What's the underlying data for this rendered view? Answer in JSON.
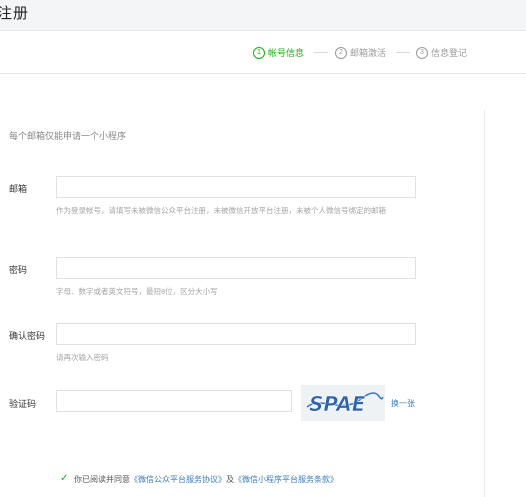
{
  "header": {
    "title": "注册"
  },
  "steps": [
    {
      "num": "1",
      "label": "帐号信息",
      "active": true
    },
    {
      "num": "2",
      "label": "邮箱激活",
      "active": false
    },
    {
      "num": "3",
      "label": "信息登记",
      "active": false
    }
  ],
  "form": {
    "intro": "每个邮箱仅能申请一个小程序",
    "email": {
      "label": "邮箱",
      "value": "",
      "hint": "作为登录帐号，请填写未被微信公众平台注册，未被微信开放平台注册，未被个人微信号绑定的邮箱"
    },
    "password": {
      "label": "密码",
      "value": "",
      "hint": "字母、数字或者英文符号，最短8位，区分大小写"
    },
    "confirm": {
      "label": "确认密码",
      "value": "",
      "hint": "请再次输入密码"
    },
    "captcha": {
      "label": "验证码",
      "value": "",
      "image_text": "SPAE",
      "refresh": "换一张"
    }
  },
  "agreement": {
    "prefix": "你已阅读并同意",
    "link1": "《微信公众平台服务协议》",
    "joiner": "及",
    "link2": "《微信小程序平台服务条款》"
  },
  "colors": {
    "accent": "#1aad19",
    "link": "#3a7cbf"
  }
}
